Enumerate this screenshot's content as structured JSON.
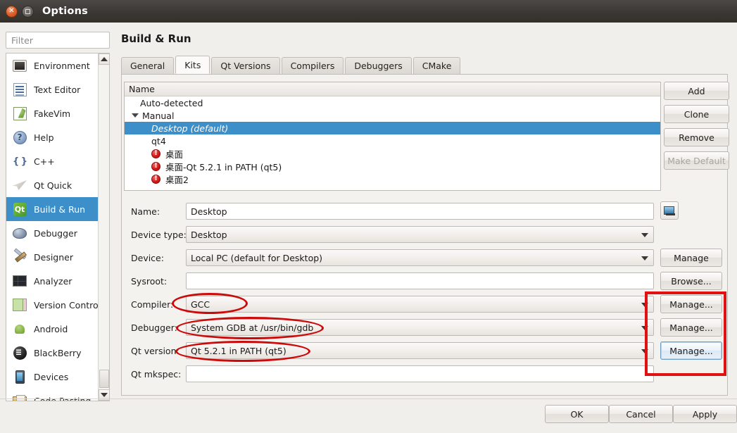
{
  "window": {
    "title": "Options",
    "close_icon": "close-icon",
    "maximize_icon": "maximize-icon"
  },
  "sidebar": {
    "filter_placeholder": "Filter",
    "filter_value": "",
    "items": [
      {
        "label": "Environment",
        "icon": "environment-icon",
        "selected": false
      },
      {
        "label": "Text Editor",
        "icon": "text-editor-icon",
        "selected": false
      },
      {
        "label": "FakeVim",
        "icon": "fakevim-icon",
        "selected": false
      },
      {
        "label": "Help",
        "icon": "help-icon",
        "selected": false
      },
      {
        "label": "C++",
        "icon": "cpp-icon",
        "selected": false
      },
      {
        "label": "Qt Quick",
        "icon": "qt-quick-icon",
        "selected": false
      },
      {
        "label": "Build & Run",
        "icon": "qt-logo-icon",
        "selected": true
      },
      {
        "label": "Debugger",
        "icon": "bug-icon",
        "selected": false
      },
      {
        "label": "Designer",
        "icon": "designer-icon",
        "selected": false
      },
      {
        "label": "Analyzer",
        "icon": "analyzer-icon",
        "selected": false
      },
      {
        "label": "Version Control",
        "icon": "version-control-icon",
        "selected": false
      },
      {
        "label": "Android",
        "icon": "android-icon",
        "selected": false
      },
      {
        "label": "BlackBerry",
        "icon": "blackberry-icon",
        "selected": false
      },
      {
        "label": "Devices",
        "icon": "devices-icon",
        "selected": false
      },
      {
        "label": "Code Pasting",
        "icon": "code-pasting-icon",
        "selected": false
      }
    ]
  },
  "main": {
    "page_title": "Build & Run",
    "tabs": [
      {
        "label": "General",
        "active": false
      },
      {
        "label": "Kits",
        "active": true
      },
      {
        "label": "Qt Versions",
        "active": false
      },
      {
        "label": "Compilers",
        "active": false
      },
      {
        "label": "Debuggers",
        "active": false
      },
      {
        "label": "CMake",
        "active": false
      }
    ],
    "kit_list": {
      "column_header": "Name",
      "rows": [
        {
          "label": "Auto-detected",
          "indent": 1,
          "expander": false,
          "error": false,
          "selected": false
        },
        {
          "label": "Manual",
          "indent": 1,
          "expander": true,
          "error": false,
          "selected": false
        },
        {
          "label": "Desktop (default)",
          "indent": 2,
          "expander": false,
          "error": false,
          "selected": true
        },
        {
          "label": "qt4",
          "indent": 2,
          "expander": false,
          "error": false,
          "selected": false
        },
        {
          "label": "桌面",
          "indent": 2,
          "expander": false,
          "error": true,
          "selected": false
        },
        {
          "label": "桌面-Qt 5.2.1 in PATH (qt5)",
          "indent": 2,
          "expander": false,
          "error": true,
          "selected": false
        },
        {
          "label": "桌面2",
          "indent": 2,
          "expander": false,
          "error": true,
          "selected": false
        }
      ]
    },
    "list_buttons": [
      {
        "label": "Add",
        "enabled": true
      },
      {
        "label": "Clone",
        "enabled": true
      },
      {
        "label": "Remove",
        "enabled": true
      },
      {
        "label": "Make Default",
        "enabled": false
      }
    ],
    "form": {
      "rows": [
        {
          "label": "Name:",
          "value": "Desktop",
          "kind": "input",
          "button": "icon",
          "button_label": "",
          "annotated": false
        },
        {
          "label": "Device type:",
          "value": "Desktop",
          "kind": "combo",
          "button": "none",
          "button_label": "",
          "annotated": false
        },
        {
          "label": "Device:",
          "value": "Local PC (default for Desktop)",
          "kind": "combo",
          "button": "normal",
          "button_label": "Manage",
          "annotated": false
        },
        {
          "label": "Sysroot:",
          "value": "",
          "kind": "input",
          "button": "normal",
          "button_label": "Browse...",
          "annotated": false
        },
        {
          "label": "Compiler:",
          "value": "GCC",
          "kind": "combo",
          "button": "normal",
          "button_label": "Manage...",
          "annotated": true
        },
        {
          "label": "Debugger:",
          "value": "System GDB at /usr/bin/gdb",
          "kind": "combo",
          "button": "normal",
          "button_label": "Manage...",
          "annotated": true
        },
        {
          "label": "Qt version:",
          "value": "Qt 5.2.1 in PATH (qt5)",
          "kind": "combo",
          "button": "focus",
          "button_label": "Manage...",
          "annotated": true
        },
        {
          "label": "Qt mkspec:",
          "value": "",
          "kind": "input",
          "button": "none",
          "button_label": "",
          "annotated": false
        }
      ]
    }
  },
  "dialog_buttons": [
    {
      "label": "OK"
    },
    {
      "label": "Cancel"
    },
    {
      "label": "Apply"
    }
  ],
  "annotations": {
    "color": "#cc0a0a",
    "shapes": [
      {
        "type": "ellipse",
        "target": "compiler-row"
      },
      {
        "type": "ellipse",
        "target": "debugger-row"
      },
      {
        "type": "ellipse",
        "target": "qt-version-row"
      },
      {
        "type": "rect",
        "target": "manage-buttons-group"
      }
    ]
  }
}
